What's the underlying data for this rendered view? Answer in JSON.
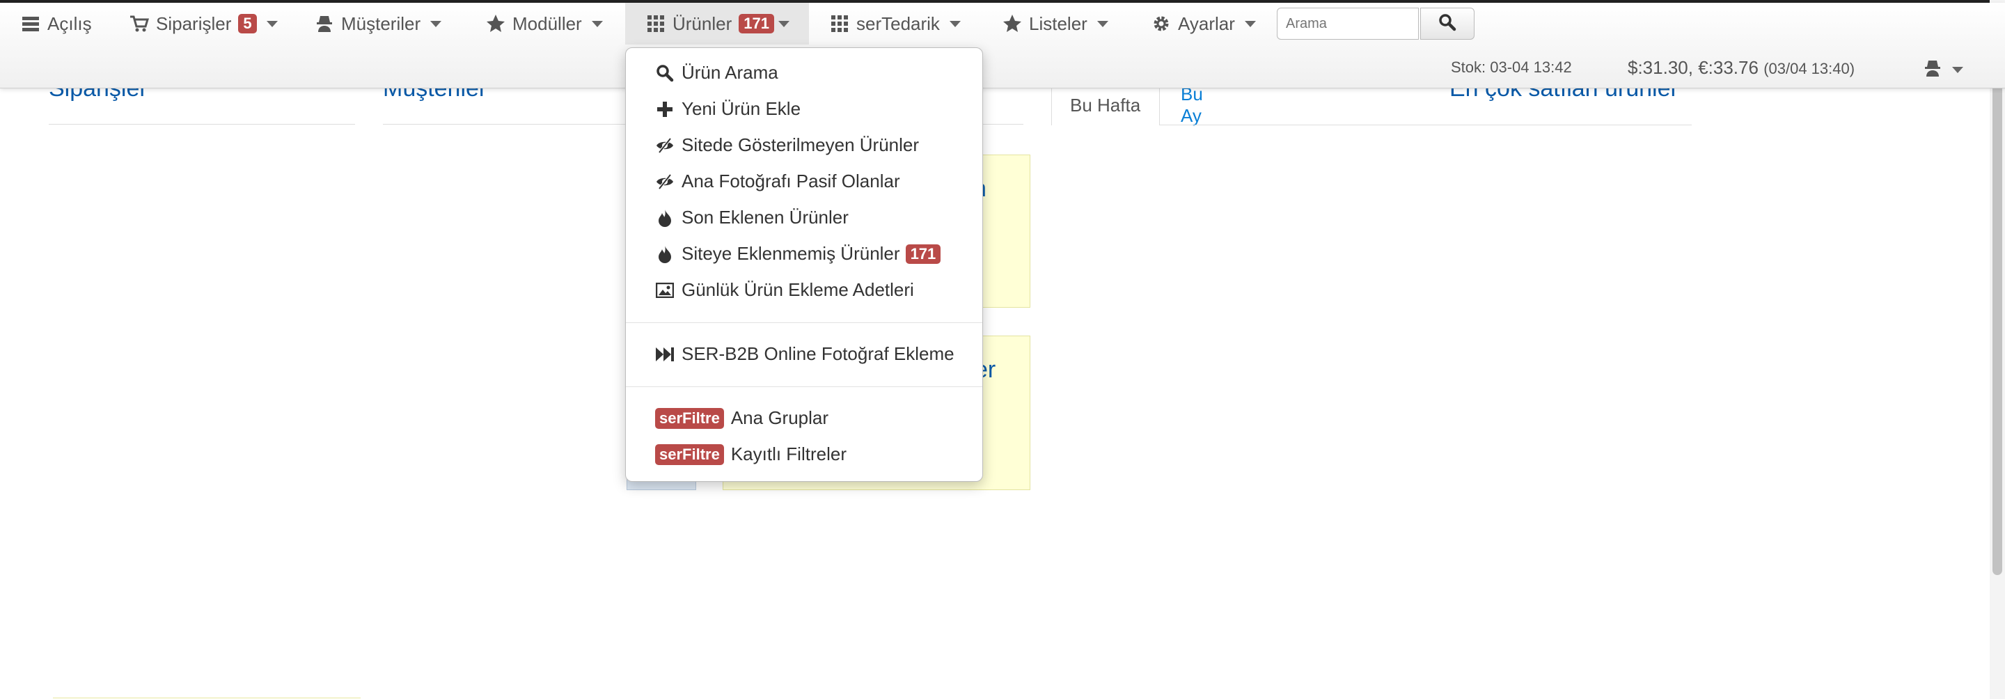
{
  "navbar": {
    "items": [
      {
        "label": "Açılış",
        "icon": "menu-list-icon"
      },
      {
        "label": "Siparişler",
        "icon": "cart-icon",
        "badge": "5"
      },
      {
        "label": "Müşteriler",
        "icon": "user-hat-icon"
      },
      {
        "label": "Modüller",
        "icon": "star-icon"
      },
      {
        "label": "Ürünler",
        "icon": "grid-icon",
        "badge": "171"
      },
      {
        "label": "serTedarik",
        "icon": "grid-icon"
      },
      {
        "label": "Listeler",
        "icon": "star-icon"
      },
      {
        "label": "Ayarlar",
        "icon": "gear-icon"
      }
    ],
    "search_placeholder": "Arama",
    "stok": "Stok: 03-04 13:42",
    "rates": "$:31.30, €:33.76",
    "rates_time": "(03/04 13:40)"
  },
  "dropdown": {
    "items": [
      {
        "label": "Ürün Arama",
        "icon": "search-icon"
      },
      {
        "label": "Yeni Ürün Ekle",
        "icon": "plus-icon"
      },
      {
        "label": "Sitede Gösterilmeyen Ürünler",
        "icon": "eye-slash-icon"
      },
      {
        "label": "Ana Fotoğrafı Pasif Olanlar",
        "icon": "eye-slash-icon"
      },
      {
        "label": "Son Eklenen Ürünler",
        "icon": "fire-icon"
      },
      {
        "label": "Siteye Eklenmemiş Ürünler",
        "icon": "fire-icon",
        "badge": "171"
      },
      {
        "label": "Günlük Ürün Ekleme Adetleri",
        "icon": "picture-icon"
      },
      {
        "label": "SER-B2B Online Fotoğraf Ekleme",
        "icon": "fast-forward-icon"
      },
      {
        "label": "Ana Gruplar",
        "badge": "serFiltre"
      },
      {
        "label": "Kayıtlı Filtreler",
        "badge": "serFiltre"
      }
    ]
  },
  "sections": {
    "siparisler": "Siparişler",
    "musteriler": "Müşteriler",
    "tab_week": "Bu Hafta",
    "tab_month": "Bu Ay",
    "top_selling": "En çok satılan ürünler",
    "yellow_box_fragment_1": "n",
    "yellow_box_fragment_2": "er"
  },
  "colors": {
    "badge": "#b94a48",
    "link": "#0a5aa8",
    "tab_link": "#0a7fd6",
    "highlight_box": "#ffffd6"
  }
}
